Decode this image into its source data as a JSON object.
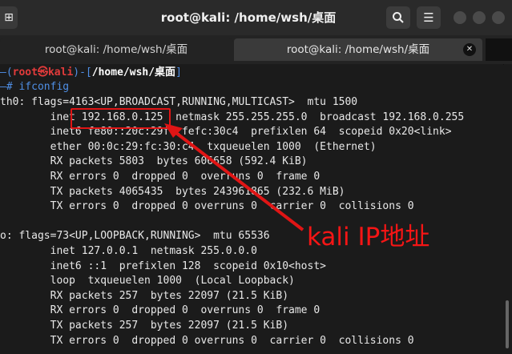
{
  "window": {
    "title": "root@kali: /home/wsh/桌面",
    "new_tab_icon": "new-tab-icon",
    "search_icon": "search-icon",
    "menu_icon": "hamburger-menu-icon"
  },
  "tabs": [
    {
      "label": "root@kali: /home/wsh/桌面",
      "active": false
    },
    {
      "label": "root@kali: /home/wsh/桌面",
      "active": true
    }
  ],
  "prompt": {
    "top_prefix": "—(",
    "user": "root",
    "at": "㉿",
    "host": "kali",
    "mid": ")-[",
    "path": "/home/wsh/桌面",
    "end": "]",
    "second_prefix": "—#",
    "command": "ifconfig"
  },
  "output_lines": [
    "th0: flags=4163<UP,BROADCAST,RUNNING,MULTICAST>  mtu 1500",
    "        inet 192.168.0.125  netmask 255.255.255.0  broadcast 192.168.0.255",
    "        inet6 fe80::20c:29ff:fefc:30c4  prefixlen 64  scopeid 0x20<link>",
    "        ether 00:0c:29:fc:30:c4  txqueuelen 1000  (Ethernet)",
    "        RX packets 5803  bytes 606658 (592.4 KiB)",
    "        RX errors 0  dropped 0  overruns 0  frame 0",
    "        TX packets 4065435  bytes 243961865 (232.6 MiB)",
    "        TX errors 0  dropped 0 overruns 0  carrier 0  collisions 0",
    "",
    "o: flags=73<UP,LOOPBACK,RUNNING>  mtu 65536",
    "        inet 127.0.0.1  netmask 255.0.0.0",
    "        inet6 ::1  prefixlen 128  scopeid 0x10<host>",
    "        loop  txqueuelen 1000  (Local Loopback)",
    "        RX packets 257  bytes 22097 (21.5 KiB)",
    "        RX errors 0  dropped 0  overruns 0  frame 0",
    "        TX packets 257  bytes 22097 (21.5 KiB)",
    "        TX errors 0  dropped 0 overruns 0  carrier 0  collisions 0"
  ],
  "annotation": {
    "text": "kali IP地址",
    "color": "#f51515"
  },
  "colors": {
    "prompt_frame": "#4f8fe6",
    "prompt_user_host": "#e33b3b",
    "annotation": "#e01515"
  }
}
